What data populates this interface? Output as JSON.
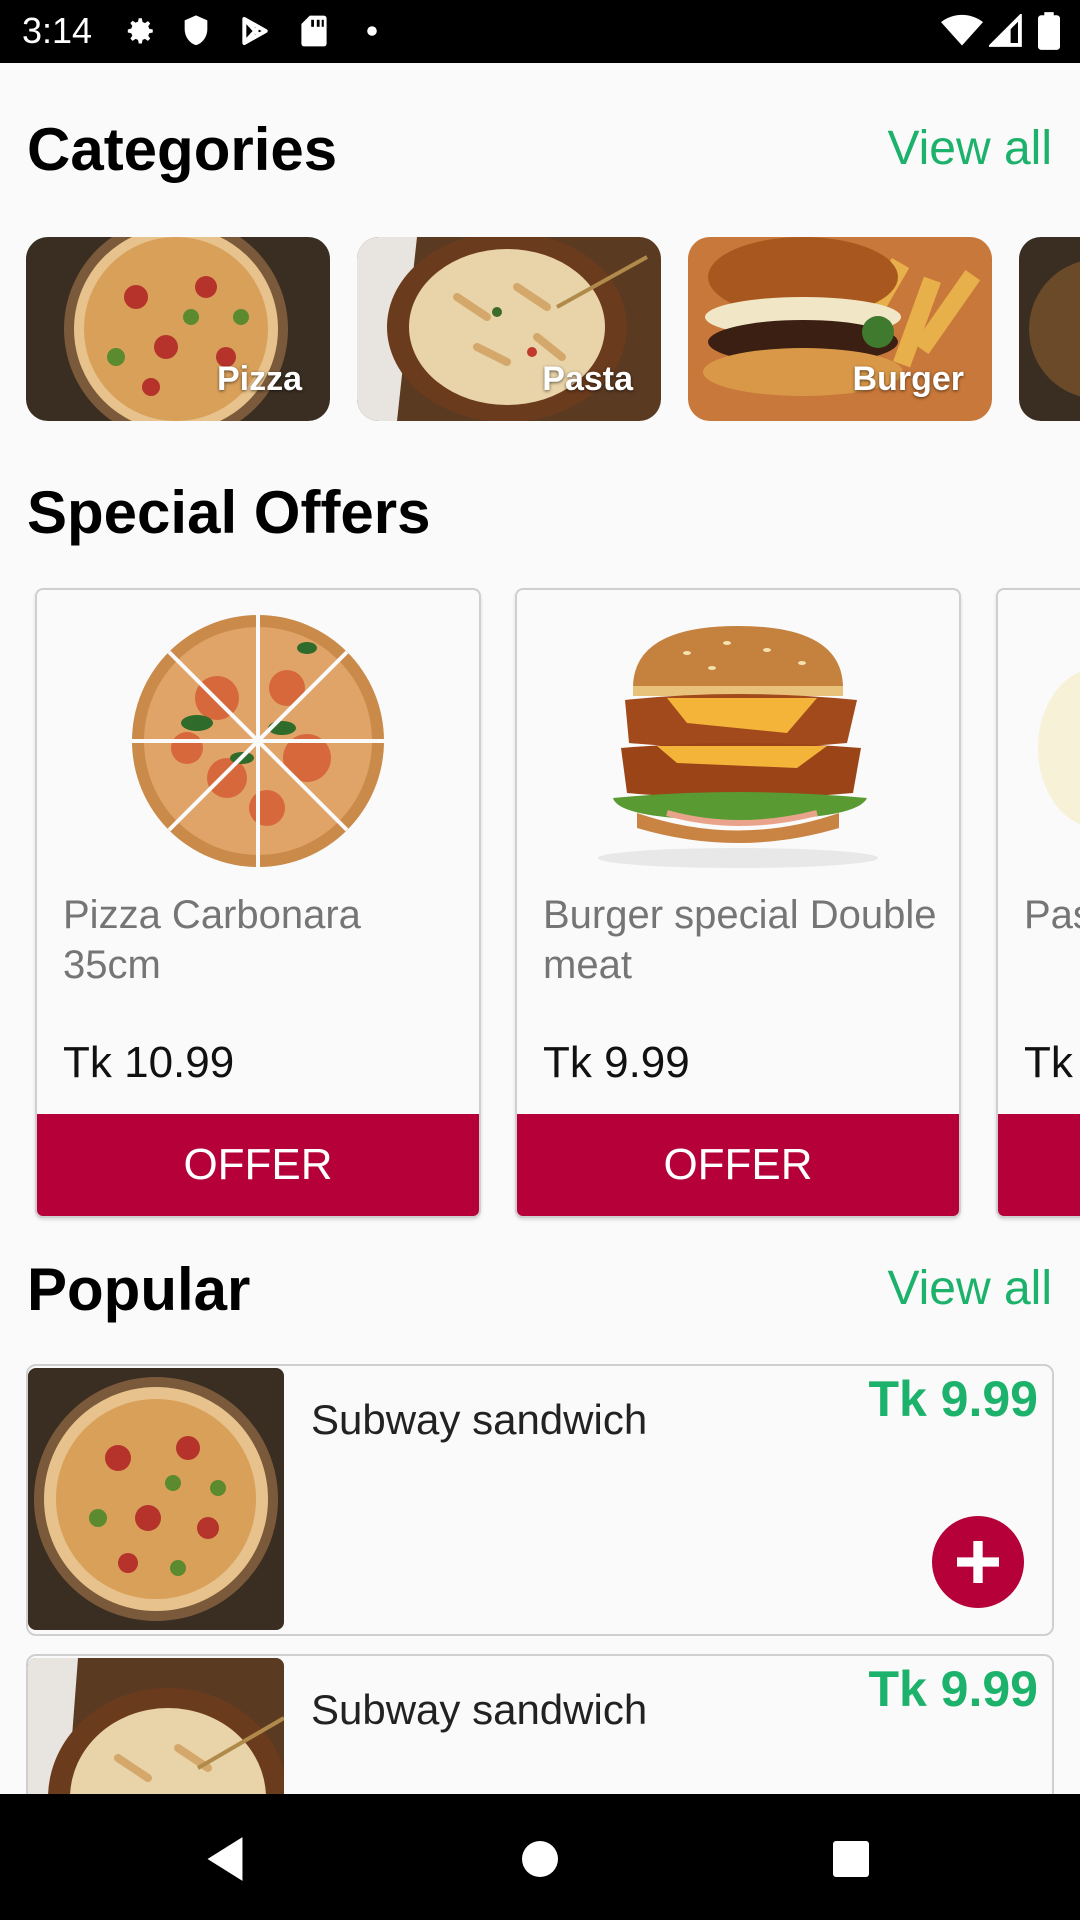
{
  "status_bar": {
    "time": "3:14",
    "left_icons": [
      "gear-icon",
      "shield-icon",
      "play-store-icon",
      "sd-card-icon",
      "dot-icon"
    ],
    "right_icons": [
      "wifi-icon",
      "signal-icon",
      "battery-icon"
    ]
  },
  "categories": {
    "title": "Categories",
    "view_all": "View all",
    "items": [
      {
        "label": "Pizza",
        "image": "pizza-photo"
      },
      {
        "label": "Pasta",
        "image": "pasta-photo"
      },
      {
        "label": "Burger",
        "image": "burger-photo"
      },
      {
        "label": "",
        "image": "partial-photo"
      }
    ]
  },
  "special_offers": {
    "title": "Special Offers",
    "items": [
      {
        "name": "Pizza Carbonara 35cm",
        "price": "Tk 10.99",
        "button": "OFFER"
      },
      {
        "name": "Burger special Double meat",
        "price": "Tk 9.99",
        "button": "OFFER"
      },
      {
        "name": "Pas Ful",
        "price": "Tk",
        "button": ""
      }
    ]
  },
  "popular": {
    "title": "Popular",
    "view_all": "View all",
    "items": [
      {
        "name": "Subway sandwich",
        "price": "Tk 9.99"
      },
      {
        "name": "Subway sandwich",
        "price": "Tk 9.99"
      }
    ]
  },
  "colors": {
    "accent_green": "#1db26b",
    "offer_red": "#b5003a",
    "background": "#fafafa"
  },
  "nav_bar": [
    "back-icon",
    "home-icon",
    "recents-icon"
  ]
}
